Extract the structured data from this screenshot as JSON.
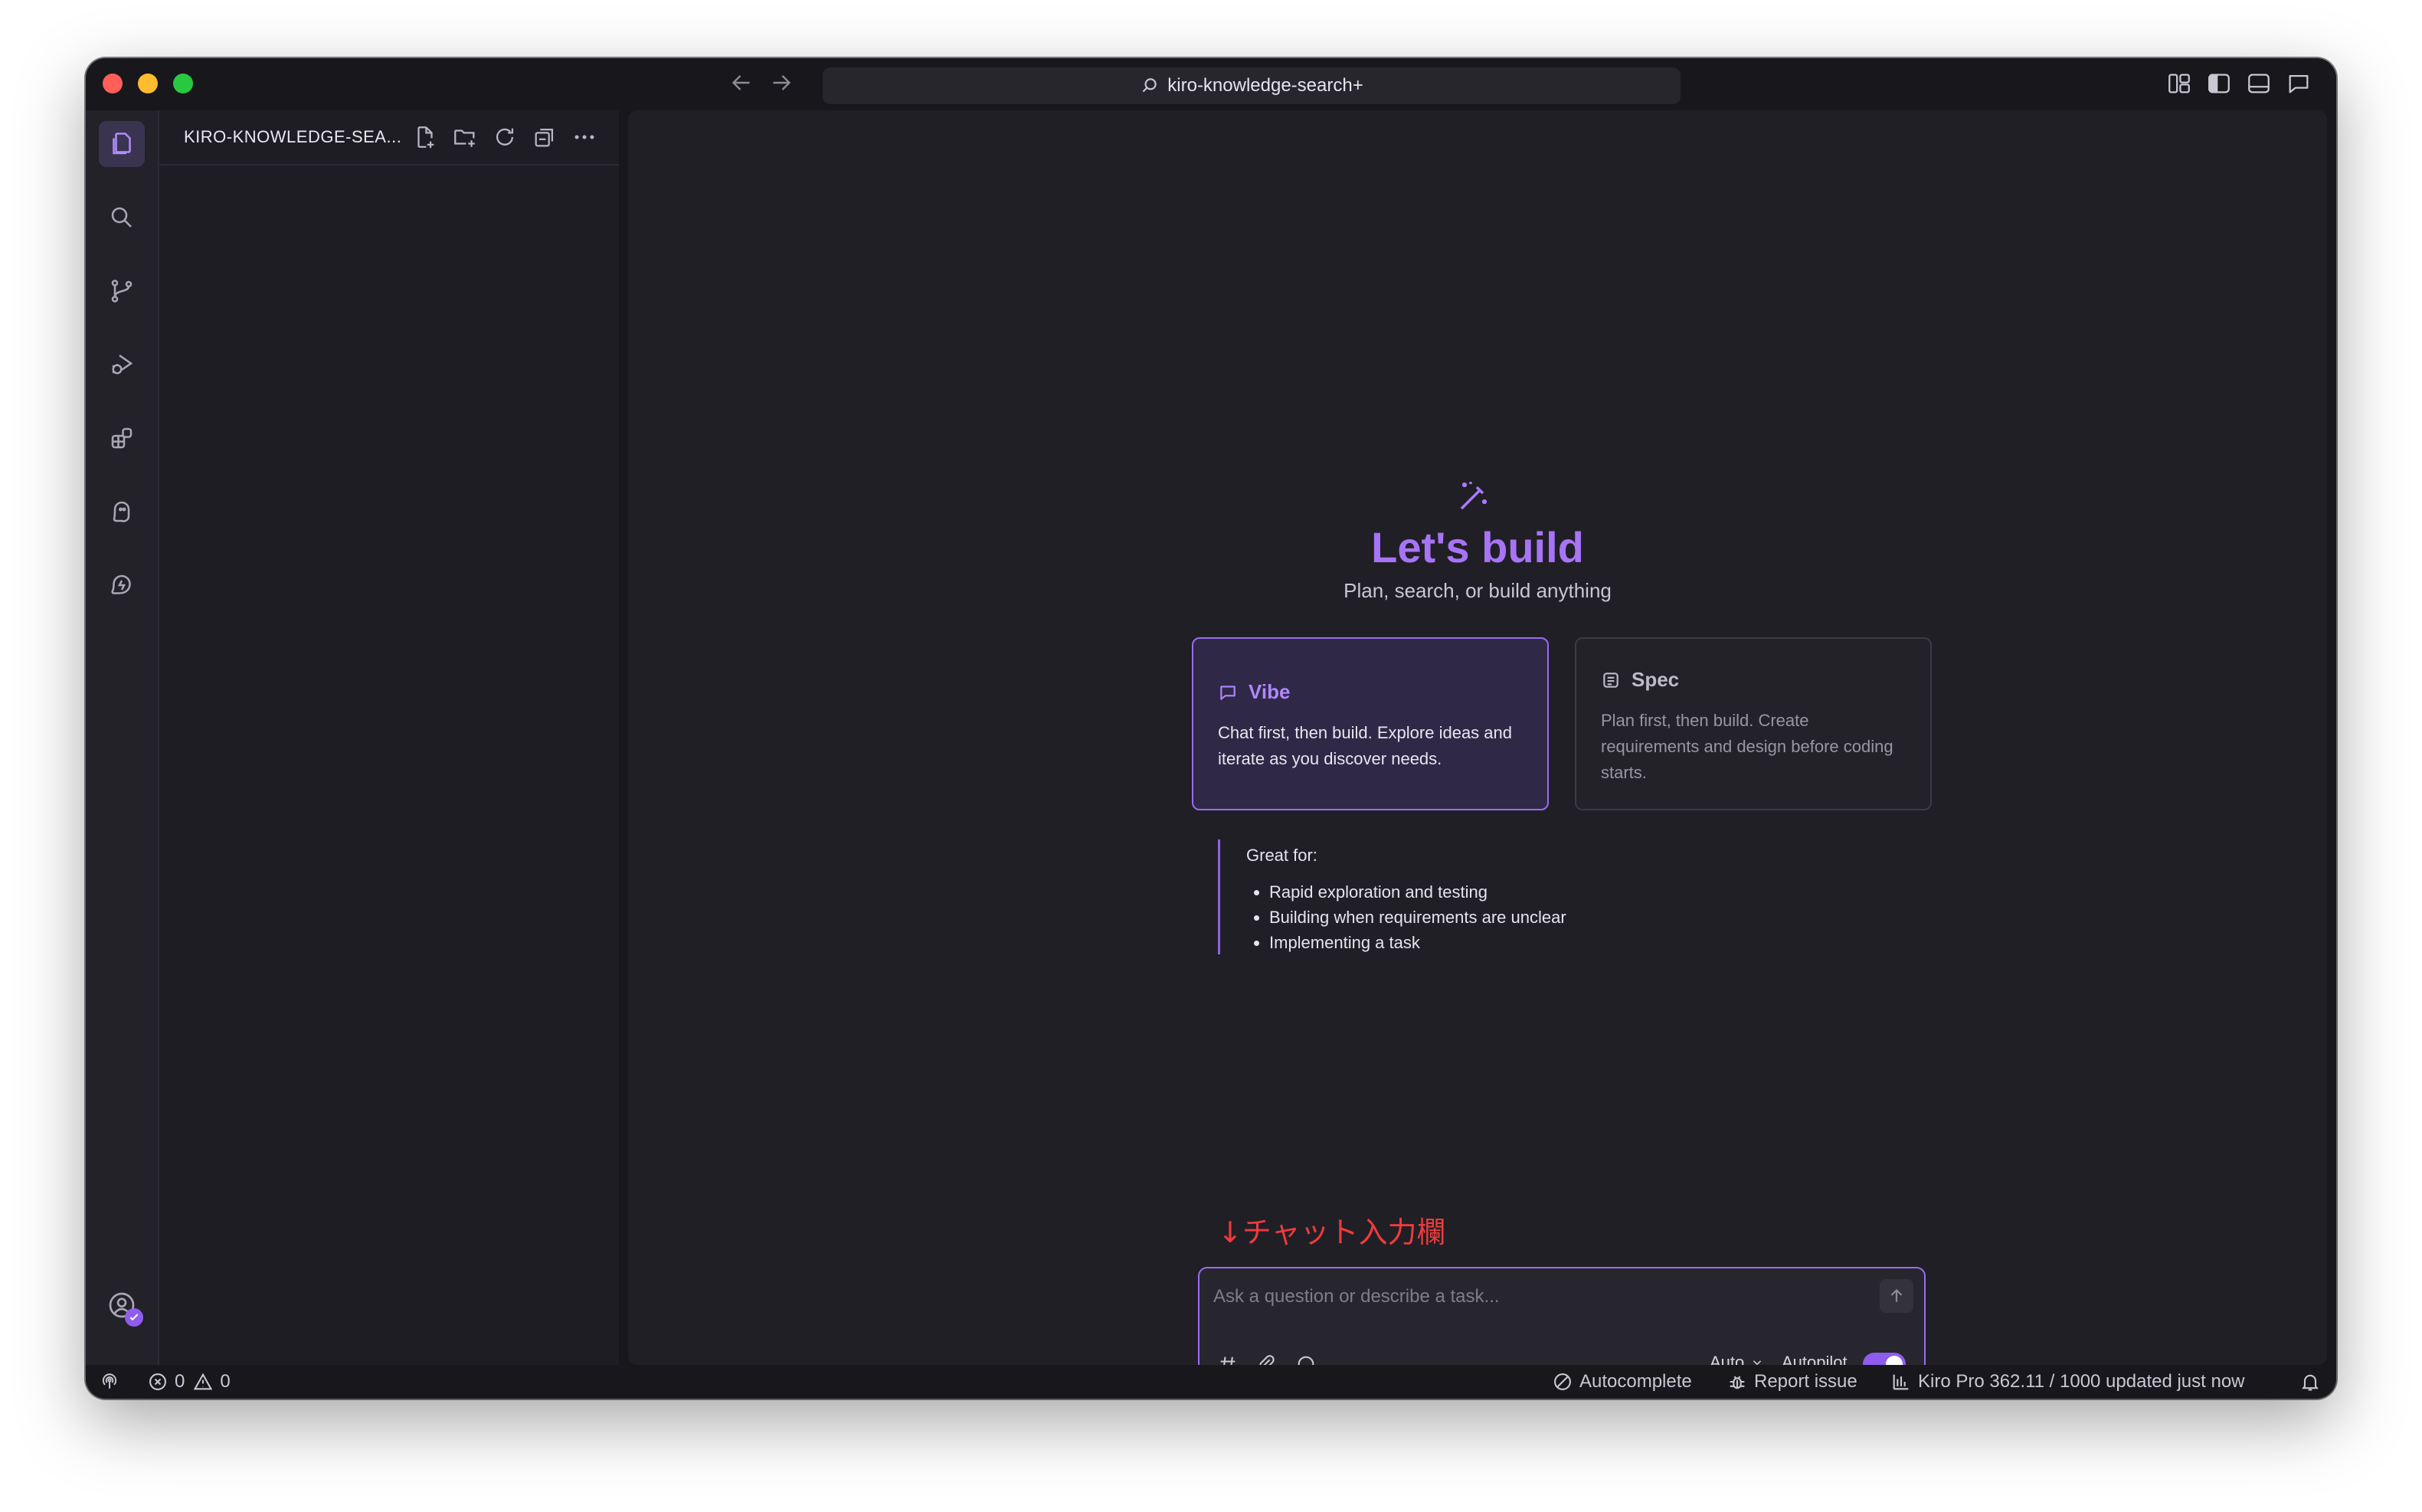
{
  "window": {
    "search_title": "kiro-knowledge-search+"
  },
  "explorer": {
    "title": "KIRO-KNOWLEDGE-SEA..."
  },
  "hero": {
    "icon": "magic-wand-icon",
    "title": "Let's build",
    "subtitle": "Plan, search, or build anything"
  },
  "modes": [
    {
      "name": "Vibe",
      "description": "Chat first, then build. Explore ideas and iterate as you discover needs.",
      "selected": true
    },
    {
      "name": "Spec",
      "description": "Plan first, then build. Create requirements and design before coding starts.",
      "selected": false
    }
  ],
  "great_for": {
    "title": "Great for:",
    "items": [
      "Rapid exploration and testing",
      "Building when requirements are unclear",
      "Implementing a task"
    ]
  },
  "annotation": "↓チャット入力欄",
  "chat": {
    "placeholder": "Ask a question or describe a task...",
    "model": "Auto",
    "autopilot_label": "Autopilot",
    "autopilot_on": true
  },
  "status": {
    "errors": "0",
    "warnings": "0",
    "autocomplete": "Autocomplete",
    "report_issue": "Report issue",
    "usage": "Kiro Pro 362.11 / 1000 updated just now"
  },
  "colors": {
    "accent": "#a774f5",
    "window_bg": "#18171c",
    "annotation": "#ef3b3b"
  }
}
